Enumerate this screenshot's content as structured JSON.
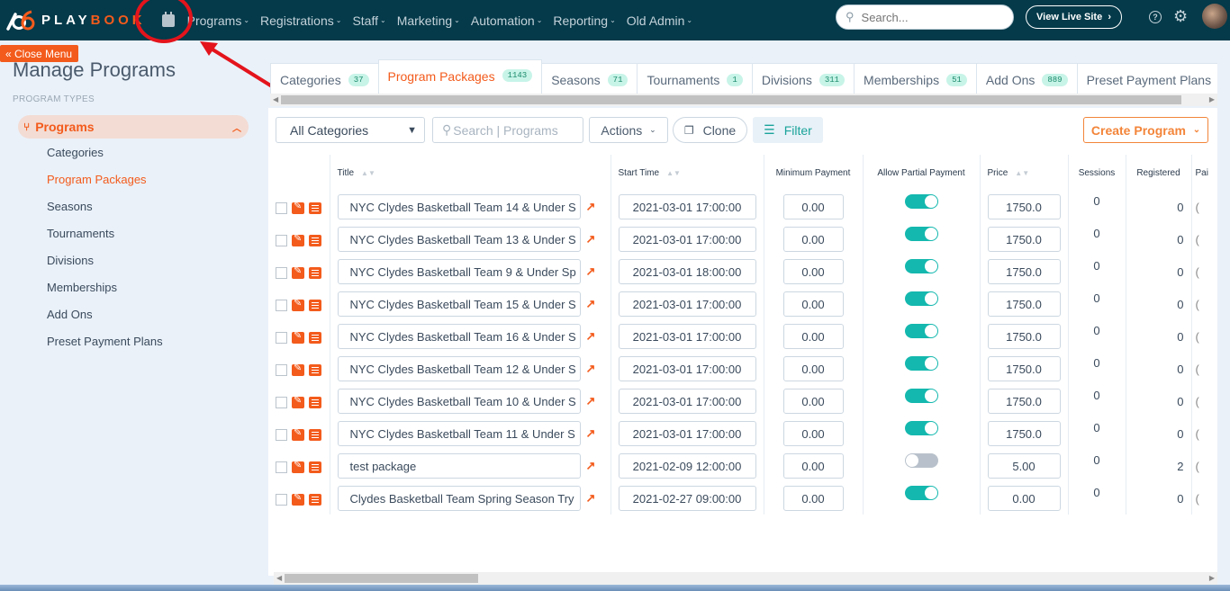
{
  "topbar": {
    "logo_play": "PLAY",
    "logo_book": "BOOK",
    "nav": [
      "Programs",
      "Registrations",
      "Staff",
      "Marketing",
      "Automation",
      "Reporting",
      "Old Admin"
    ],
    "search_placeholder": "Search...",
    "view_live_site": "View Live Site",
    "view_live_site_arrow": "›"
  },
  "sidebar": {
    "close_menu": "« Close Menu",
    "title": "Manage Programs",
    "section": "PROGRAM TYPES",
    "active_group": "Programs",
    "items": [
      {
        "label": "Categories",
        "active": false
      },
      {
        "label": "Program Packages",
        "active": true
      },
      {
        "label": "Seasons",
        "active": false
      },
      {
        "label": "Tournaments",
        "active": false
      },
      {
        "label": "Divisions",
        "active": false
      },
      {
        "label": "Memberships",
        "active": false
      },
      {
        "label": "Add Ons",
        "active": false
      },
      {
        "label": "Preset Payment Plans",
        "active": false
      }
    ]
  },
  "tabs": [
    {
      "label": "Categories",
      "count": "37"
    },
    {
      "label": "Program Packages",
      "count": "1143",
      "active": true
    },
    {
      "label": "Seasons",
      "count": "71"
    },
    {
      "label": "Tournaments",
      "count": "1"
    },
    {
      "label": "Divisions",
      "count": "311"
    },
    {
      "label": "Memberships",
      "count": "51"
    },
    {
      "label": "Add Ons",
      "count": "889"
    },
    {
      "label": "Preset Payment Plans",
      "count": ""
    }
  ],
  "toolbar": {
    "category_select": "All Categories",
    "search_placeholder": "Search | Programs",
    "actions": "Actions",
    "clone": "Clone",
    "filter": "Filter",
    "create_program": "Create Program"
  },
  "table": {
    "headers": {
      "title": "Title",
      "start_time": "Start Time",
      "min_payment": "Minimum Payment",
      "allow_partial": "Allow Partial Payment",
      "price": "Price",
      "sessions": "Sessions",
      "registered": "Registered",
      "paid": "Pai"
    },
    "rows": [
      {
        "title": "NYC Clydes Basketball Team 14 & Under S",
        "start": "2021-03-01 17:00:00",
        "min": "0.00",
        "partial": true,
        "price": "1750.0",
        "sessions": "0",
        "registered": "0"
      },
      {
        "title": "NYC Clydes Basketball Team 13 & Under S",
        "start": "2021-03-01 17:00:00",
        "min": "0.00",
        "partial": true,
        "price": "1750.0",
        "sessions": "0",
        "registered": "0"
      },
      {
        "title": "NYC Clydes Basketball Team 9 & Under Sp",
        "start": "2021-03-01 18:00:00",
        "min": "0.00",
        "partial": true,
        "price": "1750.0",
        "sessions": "0",
        "registered": "0"
      },
      {
        "title": "NYC Clydes Basketball Team 15 & Under S",
        "start": "2021-03-01 17:00:00",
        "min": "0.00",
        "partial": true,
        "price": "1750.0",
        "sessions": "0",
        "registered": "0"
      },
      {
        "title": "NYC Clydes Basketball Team 16 & Under S",
        "start": "2021-03-01 17:00:00",
        "min": "0.00",
        "partial": true,
        "price": "1750.0",
        "sessions": "0",
        "registered": "0"
      },
      {
        "title": "NYC Clydes Basketball Team 12 & Under S",
        "start": "2021-03-01 17:00:00",
        "min": "0.00",
        "partial": true,
        "price": "1750.0",
        "sessions": "0",
        "registered": "0"
      },
      {
        "title": "NYC Clydes Basketball Team 10 & Under S",
        "start": "2021-03-01 17:00:00",
        "min": "0.00",
        "partial": true,
        "price": "1750.0",
        "sessions": "0",
        "registered": "0"
      },
      {
        "title": "NYC Clydes Basketball Team 11 & Under S",
        "start": "2021-03-01 17:00:00",
        "min": "0.00",
        "partial": true,
        "price": "1750.0",
        "sessions": "0",
        "registered": "0"
      },
      {
        "title": "test package",
        "start": "2021-02-09 12:00:00",
        "min": "0.00",
        "partial": false,
        "price": "5.00",
        "sessions": "0",
        "registered": "2"
      },
      {
        "title": "Clydes Basketball Team Spring Season Try",
        "start": "2021-02-27 09:00:00",
        "min": "0.00",
        "partial": true,
        "price": "0.00",
        "sessions": "0",
        "registered": "0"
      }
    ]
  },
  "colors": {
    "brand_orange": "#f35b1c",
    "topbar": "#043a4a",
    "toggle_on": "#14b8ae",
    "badge_bg": "#c8f4e8"
  }
}
